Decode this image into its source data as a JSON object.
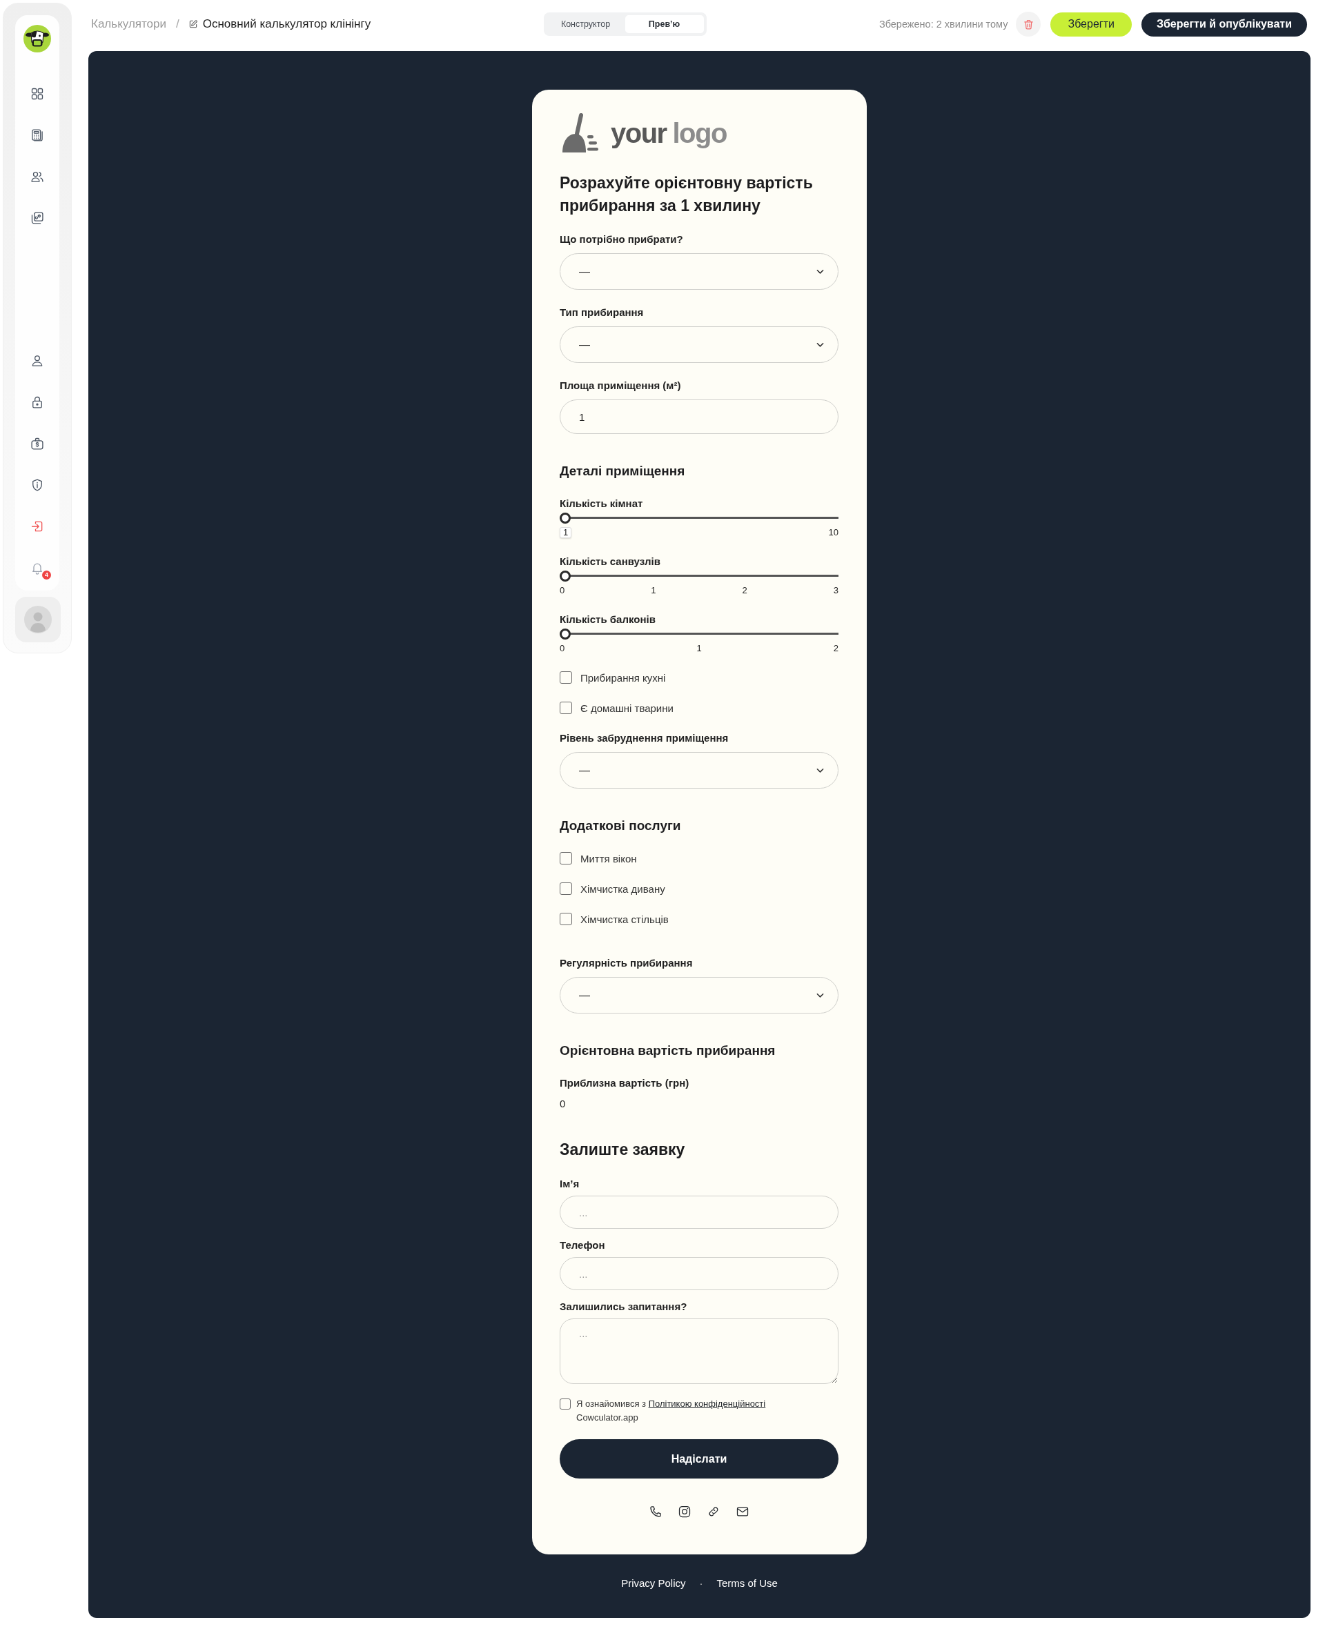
{
  "sidebar": {
    "notification_badge": "4"
  },
  "top_bar": {
    "breadcrumb": {
      "parent": "Калькулятори",
      "separator": "/",
      "current": "Основний калькулятор клінінгу"
    },
    "mode_tabs": [
      {
        "label": "Конструктор",
        "selected": false
      },
      {
        "label": "Прев’ю",
        "selected": true
      }
    ],
    "save_status": "Збережено: 2 хвилини тому",
    "buttons": [
      {
        "label": "Зберегти",
        "kind": "save"
      },
      {
        "label": "Зберегти й опублікувати",
        "kind": "publish"
      }
    ]
  },
  "form": {
    "logo": {
      "words": [
        "your",
        "logo"
      ]
    },
    "title": "Розрахуйте орієнтовну вартість прибирання за 1 хвилину",
    "sections": [
      {
        "kind": "plain",
        "items": [
          {
            "kind": "select",
            "label": "Що потрібно прибрати?",
            "value": "—"
          },
          {
            "kind": "select",
            "label": "Тип прибирання",
            "value": "—"
          },
          {
            "kind": "input",
            "label": "Площа приміщення (м²)",
            "value": "1"
          }
        ]
      },
      {
        "kind": "group",
        "heading": "Деталі приміщення",
        "items": [
          {
            "kind": "slider",
            "label": "Кількість кімнат",
            "level": 0,
            "ticks": [
              {
                "label": "1",
                "boxed": true
              },
              {
                "label": "10",
                "boxed": false
              }
            ]
          },
          {
            "kind": "slider",
            "label": "Кількість санвузлів",
            "level": 0,
            "ticks": [
              {
                "label": "0",
                "boxed": false
              },
              {
                "label": "1",
                "boxed": false
              },
              {
                "label": "2",
                "boxed": false
              },
              {
                "label": "3",
                "boxed": false
              }
            ]
          },
          {
            "kind": "slider",
            "label": "Кількість балконів",
            "level": 0,
            "ticks": [
              {
                "label": "0",
                "boxed": false
              },
              {
                "label": "1",
                "boxed": false
              },
              {
                "label": "2",
                "boxed": false
              }
            ]
          },
          {
            "kind": "checkbox",
            "label": "Прибирання кухні",
            "checked": false
          },
          {
            "kind": "checkbox",
            "label": "Є домашні тварини",
            "checked": false
          },
          {
            "kind": "select",
            "label": "Рівень забруднення приміщення",
            "value": "—"
          }
        ]
      },
      {
        "kind": "group",
        "heading": "Додаткові послуги",
        "items": [
          {
            "kind": "checkbox",
            "label": "Миття вікон",
            "checked": false
          },
          {
            "kind": "checkbox",
            "label": "Хімчистка дивану",
            "checked": false
          },
          {
            "kind": "checkbox",
            "label": "Хімчистка стільців",
            "checked": false
          }
        ]
      },
      {
        "kind": "plain",
        "items": [
          {
            "kind": "select",
            "label": "Регулярність прибирання",
            "value": "—"
          }
        ]
      },
      {
        "kind": "group",
        "heading": "Орієнтовна вартість прибирання",
        "items": [
          {
            "kind": "output",
            "label": "Приблизна вартість (грн)",
            "value": "0"
          }
        ]
      },
      {
        "kind": "contact",
        "heading": "Залиште заявку",
        "items": [
          {
            "kind": "input",
            "label": "Ім’я",
            "placeholder": "..."
          },
          {
            "kind": "input",
            "label": "Телефон",
            "placeholder": "..."
          },
          {
            "kind": "textarea",
            "label": "Залишились запитання?",
            "placeholder": "..."
          },
          {
            "kind": "consent",
            "text": "Я ознайомився з",
            "link": "Політикою конфіденційності",
            "suffix": "Cowculator.app",
            "checked": false
          }
        ]
      }
    ],
    "submit_button": "Надіслати"
  },
  "footer": {
    "links": [
      "Privacy Policy",
      "Terms of Use"
    ],
    "separator": "·"
  }
}
